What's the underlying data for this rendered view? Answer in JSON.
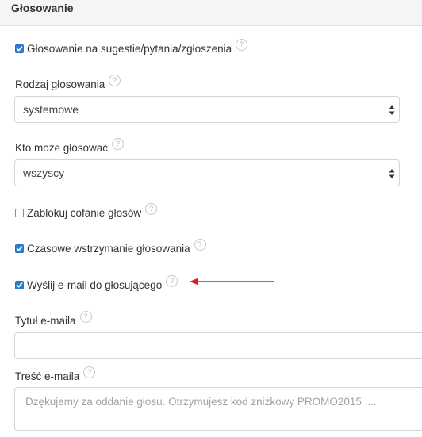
{
  "panel": {
    "title": "Głosowanie"
  },
  "voting_enabled": {
    "label": "Głosowanie na sugestie/pytania/zgłoszenia",
    "checked": true
  },
  "voting_type": {
    "label": "Rodzaj głosowania",
    "value": "systemowe"
  },
  "who_can_vote": {
    "label": "Kto może głosować",
    "value": "wszyscy"
  },
  "block_vote_undo": {
    "label": "Zablokuj cofanie głosów",
    "checked": false
  },
  "temp_suspend": {
    "label": "Czasowe wstrzymanie głosowania",
    "checked": true
  },
  "send_email": {
    "label": "Wyślij e-mail do głosującego",
    "checked": true
  },
  "email_title": {
    "label": "Tytuł e-maila",
    "value": ""
  },
  "email_body": {
    "label": "Treść e-maila",
    "placeholder": "Dzękujemy za oddanie głosu. Otrzymujesz kod zniżkowy PROMO2015 ...."
  },
  "help_icon": {
    "glyph": "?",
    "icon": "help-circle-icon"
  },
  "colors": {
    "accent": "#2f7fd1",
    "annotation": "#e0171d",
    "border": "#d4d4d4"
  }
}
